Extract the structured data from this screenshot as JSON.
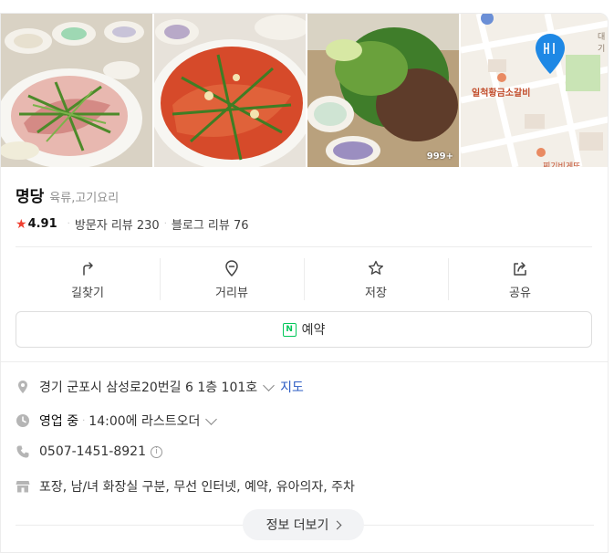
{
  "photos": {
    "count_badge": "999+",
    "map_labels": [
      "일척황금소갈비",
      "대기",
      "찌기비게또"
    ]
  },
  "place": {
    "name": "명당",
    "category": "육류,고기요리"
  },
  "rating": {
    "score": "4.91",
    "visitor_reviews": "방문자 리뷰 230",
    "blog_reviews": "블로그 리뷰 76"
  },
  "actions": [
    {
      "label": "길찾기",
      "icon": "directions-icon"
    },
    {
      "label": "거리뷰",
      "icon": "pin-icon"
    },
    {
      "label": "저장",
      "icon": "star-icon"
    },
    {
      "label": "공유",
      "icon": "share-icon"
    }
  ],
  "reserve": {
    "label": "예약",
    "icon_text": "N"
  },
  "info": {
    "address": "경기 군포시 삼성로20번길 6 1층 101호",
    "map_link": "지도",
    "status": "영업 중",
    "last_order": "14:00에 라스트오더",
    "phone": "0507-1451-8921",
    "amenities": "포장, 남/녀 화장실 구분, 무선 인터넷, 예약, 유아의자, 주차"
  },
  "more_button": "정보 더보기",
  "colors": {
    "star": "#f03f30",
    "naver_green": "#03c75a",
    "map_pin": "#1e88e5",
    "link": "#2d5cc4"
  }
}
